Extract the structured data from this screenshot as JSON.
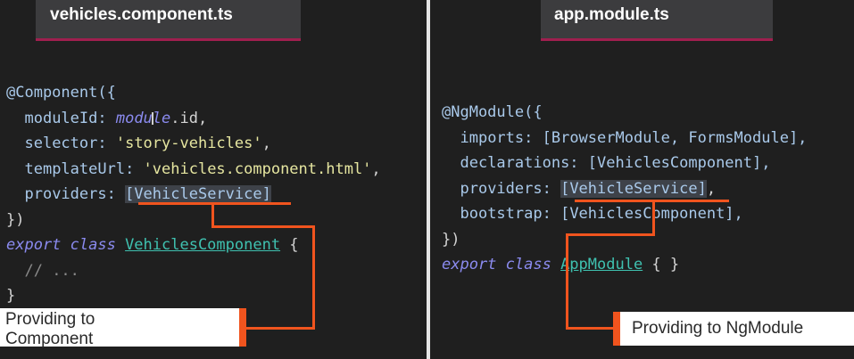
{
  "left": {
    "tab_title": "vehicles.component.ts",
    "code": {
      "l1_decorator": "@Component({",
      "l2_key": "moduleId: ",
      "l2_module_a": "modu",
      "l2_module_b": "le",
      "l2_rest": ".id,",
      "l3_key": "selector: ",
      "l3_str": "'story-vehicles'",
      "l3_end": ",",
      "l4_key": "templateUrl: ",
      "l4_str": "'vehicles.component.html'",
      "l4_end": ",",
      "l5_key": "providers: ",
      "l5_value": "[VehicleService]",
      "l6": "})",
      "l7_kw": "export class ",
      "l7_cls": "VehiclesComponent",
      "l7_end": " {",
      "l8_comment": "// ...",
      "l9": "}"
    },
    "callout_line1": "Providing to",
    "callout_line2": "Component"
  },
  "right": {
    "tab_title": "app.module.ts",
    "code": {
      "l1_decorator": "@NgModule({",
      "l2_key": "imports: ",
      "l2_value": "[BrowserModule, FormsModule],",
      "l3_key": "declarations: ",
      "l3_value": "[VehiclesComponent],",
      "l4_key": "providers: ",
      "l4_value": "[VehicleService]",
      "l4_end": ",",
      "l5_key": "bootstrap: ",
      "l5_value": "[VehiclesComponent],",
      "l6": "})",
      "l7_kw": "export class ",
      "l7_cls": "AppModule",
      "l7_end": " { }"
    },
    "callout": "Providing to NgModule"
  },
  "colors": {
    "background": "#1f1f1f",
    "tab_background": "#3c3c3e",
    "tab_underline": "#a01f4f",
    "callout_accent": "#f0541e",
    "keyword": "#8b8bf0",
    "string": "#e6e6a0",
    "class_name": "#3fc1b0"
  }
}
